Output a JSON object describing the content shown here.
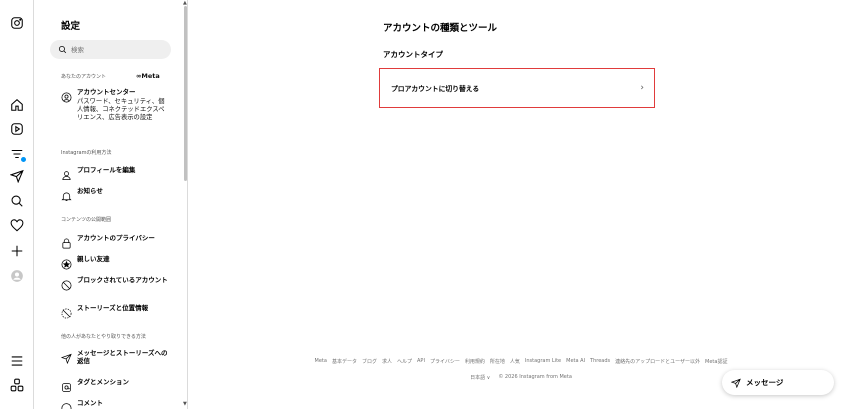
{
  "rail": {
    "icons": [
      "instagram-icon",
      "home-icon",
      "reels-icon",
      "feed-filter-icon",
      "send-icon",
      "search-icon",
      "heart-icon",
      "plus-icon",
      "profile-icon",
      "menu-icon",
      "threads-icon"
    ]
  },
  "sidebar": {
    "title": "設定",
    "search_placeholder": "検索",
    "your_account_label": "あなたのアカウント",
    "meta_logo": "∞Meta",
    "account_center": {
      "title": "アカウントセンター",
      "description": "パスワード、セキュリティ、個人情報、コネクテッドエクスペリエンス、広告表示の設定"
    },
    "usage_section": "Instagramの利用方法",
    "edit_profile": "プロフィールを編集",
    "notifications": "お知らせ",
    "visibility_section": "コンテンツの公開範囲",
    "account_privacy": "アカウントのプライバシー",
    "close_friends": "親しい友達",
    "blocked_accounts": "ブロックされているアカウント",
    "story_location": "ストーリーズと位置情報",
    "interaction_section": "他の人があなたとやり取りできる方法",
    "messages_replies": "メッセージとストーリーズへの返信",
    "tags_mentions": "タグとメンション",
    "comments": "コメント"
  },
  "main": {
    "title": "アカウントの種類とツール",
    "subtitle": "アカウントタイプ",
    "switch_label": "プロアカウントに切り替える",
    "chevron": "›"
  },
  "footer": {
    "links": [
      "Meta",
      "基本データ",
      "ブログ",
      "求人",
      "ヘルプ",
      "API",
      "プライバシー",
      "利用規約",
      "所在地",
      "人気",
      "Instagram Lite",
      "Meta AI",
      "Threads",
      "連絡先のアップロードとユーザー以外",
      "Meta認証"
    ],
    "language": "日本語 ∨",
    "copyright": "© 2026 Instagram from Meta"
  },
  "messages_button": {
    "label": "メッセージ"
  }
}
